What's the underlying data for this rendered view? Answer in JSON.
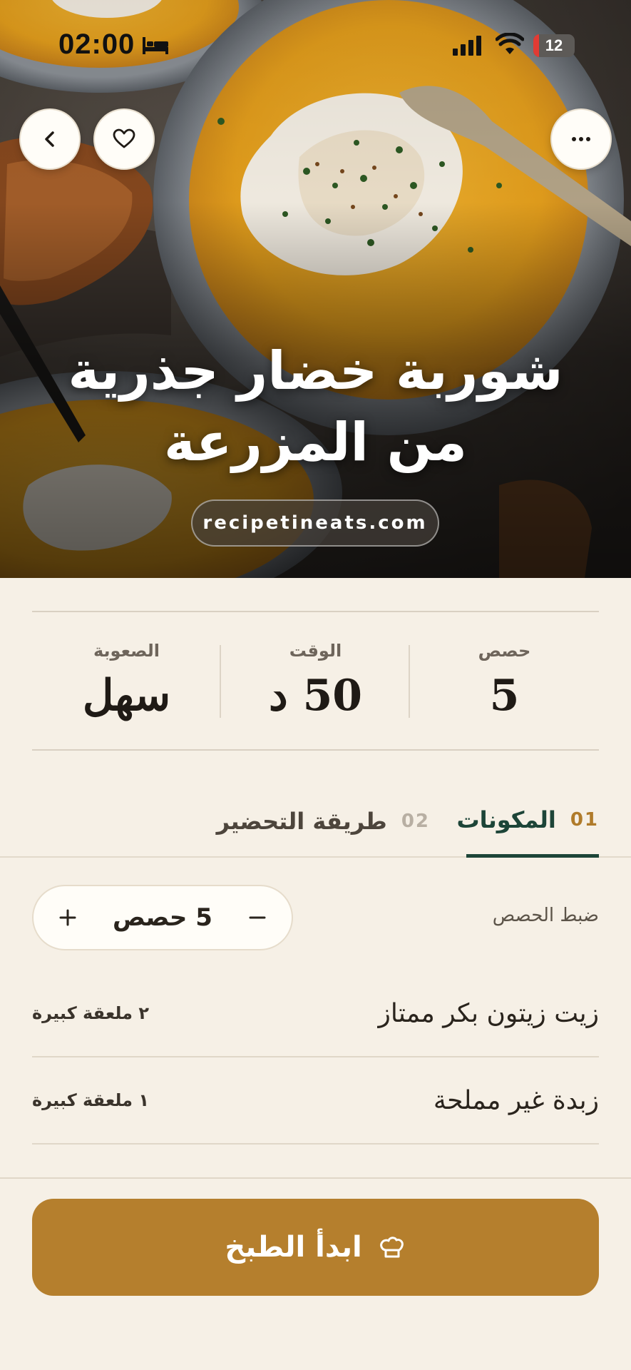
{
  "status_bar": {
    "time": "02:00",
    "battery": "12"
  },
  "header": {
    "back_icon": "chevron-left-icon",
    "favorite_icon": "heart-icon",
    "more_icon": "more-horizontal-icon"
  },
  "recipe": {
    "title": "شوربة خضار جذرية من المزرعة",
    "source": "recipetineats.com"
  },
  "stats": {
    "servings_label": "حصص",
    "servings_value": "5",
    "time_label": "الوقت",
    "time_value": "50 د",
    "difficulty_label": "الصعوبة",
    "difficulty_value": "سهل"
  },
  "tabs": [
    {
      "num": "01",
      "label": "المكونات",
      "active": true
    },
    {
      "num": "02",
      "label": "طريقة التحضير",
      "active": false
    }
  ],
  "servings": {
    "label": "ضبط الحصص",
    "value": "5 حصص"
  },
  "ingredients": [
    {
      "name": "زيت زيتون بكر ممتاز",
      "qty": "٢ ملعقة كبيرة"
    },
    {
      "name": "زبدة غير مملحة",
      "qty": "١ ملعقة كبيرة"
    }
  ],
  "cta": {
    "label": "ابدأ الطبخ",
    "icon": "chef-hat-icon"
  },
  "colors": {
    "background": "#f6f0e6",
    "accent": "#b57f2d",
    "tab_active": "#1d4538"
  }
}
